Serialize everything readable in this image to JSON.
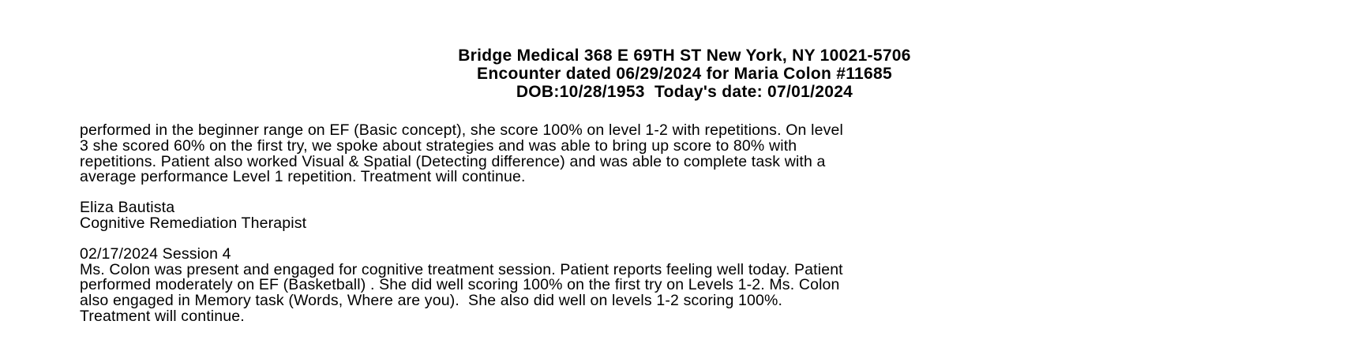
{
  "header": {
    "line1": "Bridge Medical 368 E 69TH ST New York, NY 10021-5706",
    "line2": "Encounter dated 06/29/2024 for Maria Colon #11685",
    "line3": "DOB:10/28/1953  Today's date: 07/01/2024"
  },
  "note_continued": {
    "lines": [
      "performed in the beginner range on EF (Basic concept), she score 100% on level 1-2 with repetitions. On level",
      "3 she scored 60% on the first try, we spoke about strategies and was able to bring up score to 80% with",
      "repetitions. Patient also worked Visual & Spatial (Detecting difference) and was able to complete task with a",
      "average performance Level 1 repetition. Treatment will continue."
    ]
  },
  "signature": {
    "name": "Eliza Bautista",
    "title": "Cognitive Remediation Therapist"
  },
  "session4": {
    "heading": "02/17/2024 Session 4",
    "lines": [
      "Ms. Colon was present and engaged for cognitive treatment session. Patient reports feeling well today. Patient",
      "performed moderately on EF (Basketball) . She did well scoring 100% on the first try on Levels 1-2. Ms. Colon",
      "also engaged in Memory task (Words, Where are you).  She also did well on levels 1-2 scoring 100%.",
      "Treatment will continue."
    ]
  }
}
